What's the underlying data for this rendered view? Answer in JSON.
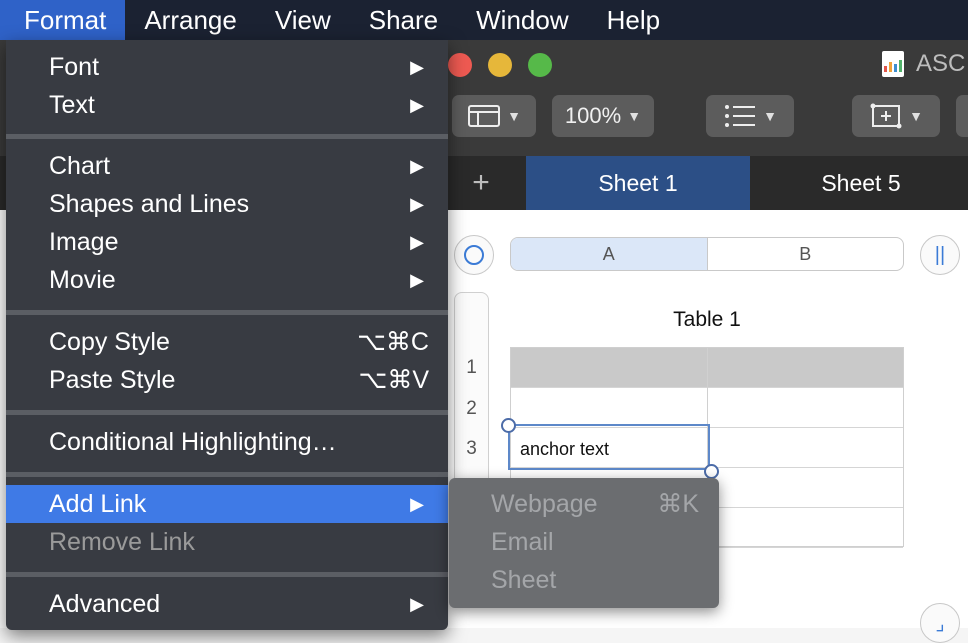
{
  "menubar": {
    "items": [
      "Format",
      "Arrange",
      "View",
      "Share",
      "Window",
      "Help"
    ]
  },
  "window": {
    "title": "ASC",
    "toolbar": {
      "zoom": "100%"
    },
    "tabs": [
      "Sheet 1",
      "Sheet 5"
    ],
    "add_sheet": "+"
  },
  "sheet": {
    "columns": [
      "A",
      "B"
    ],
    "rows": [
      "1",
      "2",
      "3"
    ],
    "table_title": "Table 1",
    "selected_cell_text": "anchor text"
  },
  "format_menu": {
    "items": [
      {
        "label": "Font"
      },
      {
        "label": "Text"
      },
      {
        "label": "Chart"
      },
      {
        "label": "Shapes and Lines"
      },
      {
        "label": "Image"
      },
      {
        "label": "Movie"
      },
      {
        "label": "Copy Style",
        "shortcut": "⌥⌘C"
      },
      {
        "label": "Paste Style",
        "shortcut": "⌥⌘V"
      },
      {
        "label": "Conditional Highlighting…"
      },
      {
        "label": "Add Link"
      },
      {
        "label": "Remove Link"
      },
      {
        "label": "Advanced"
      }
    ]
  },
  "link_submenu": {
    "items": [
      {
        "label": "Webpage",
        "shortcut": "⌘K"
      },
      {
        "label": "Email"
      },
      {
        "label": "Sheet"
      }
    ]
  },
  "colors": {
    "menu_highlight": "#3f7ae6",
    "menubar_active": "#2f62c8",
    "active_tab": "#2c4f86"
  }
}
